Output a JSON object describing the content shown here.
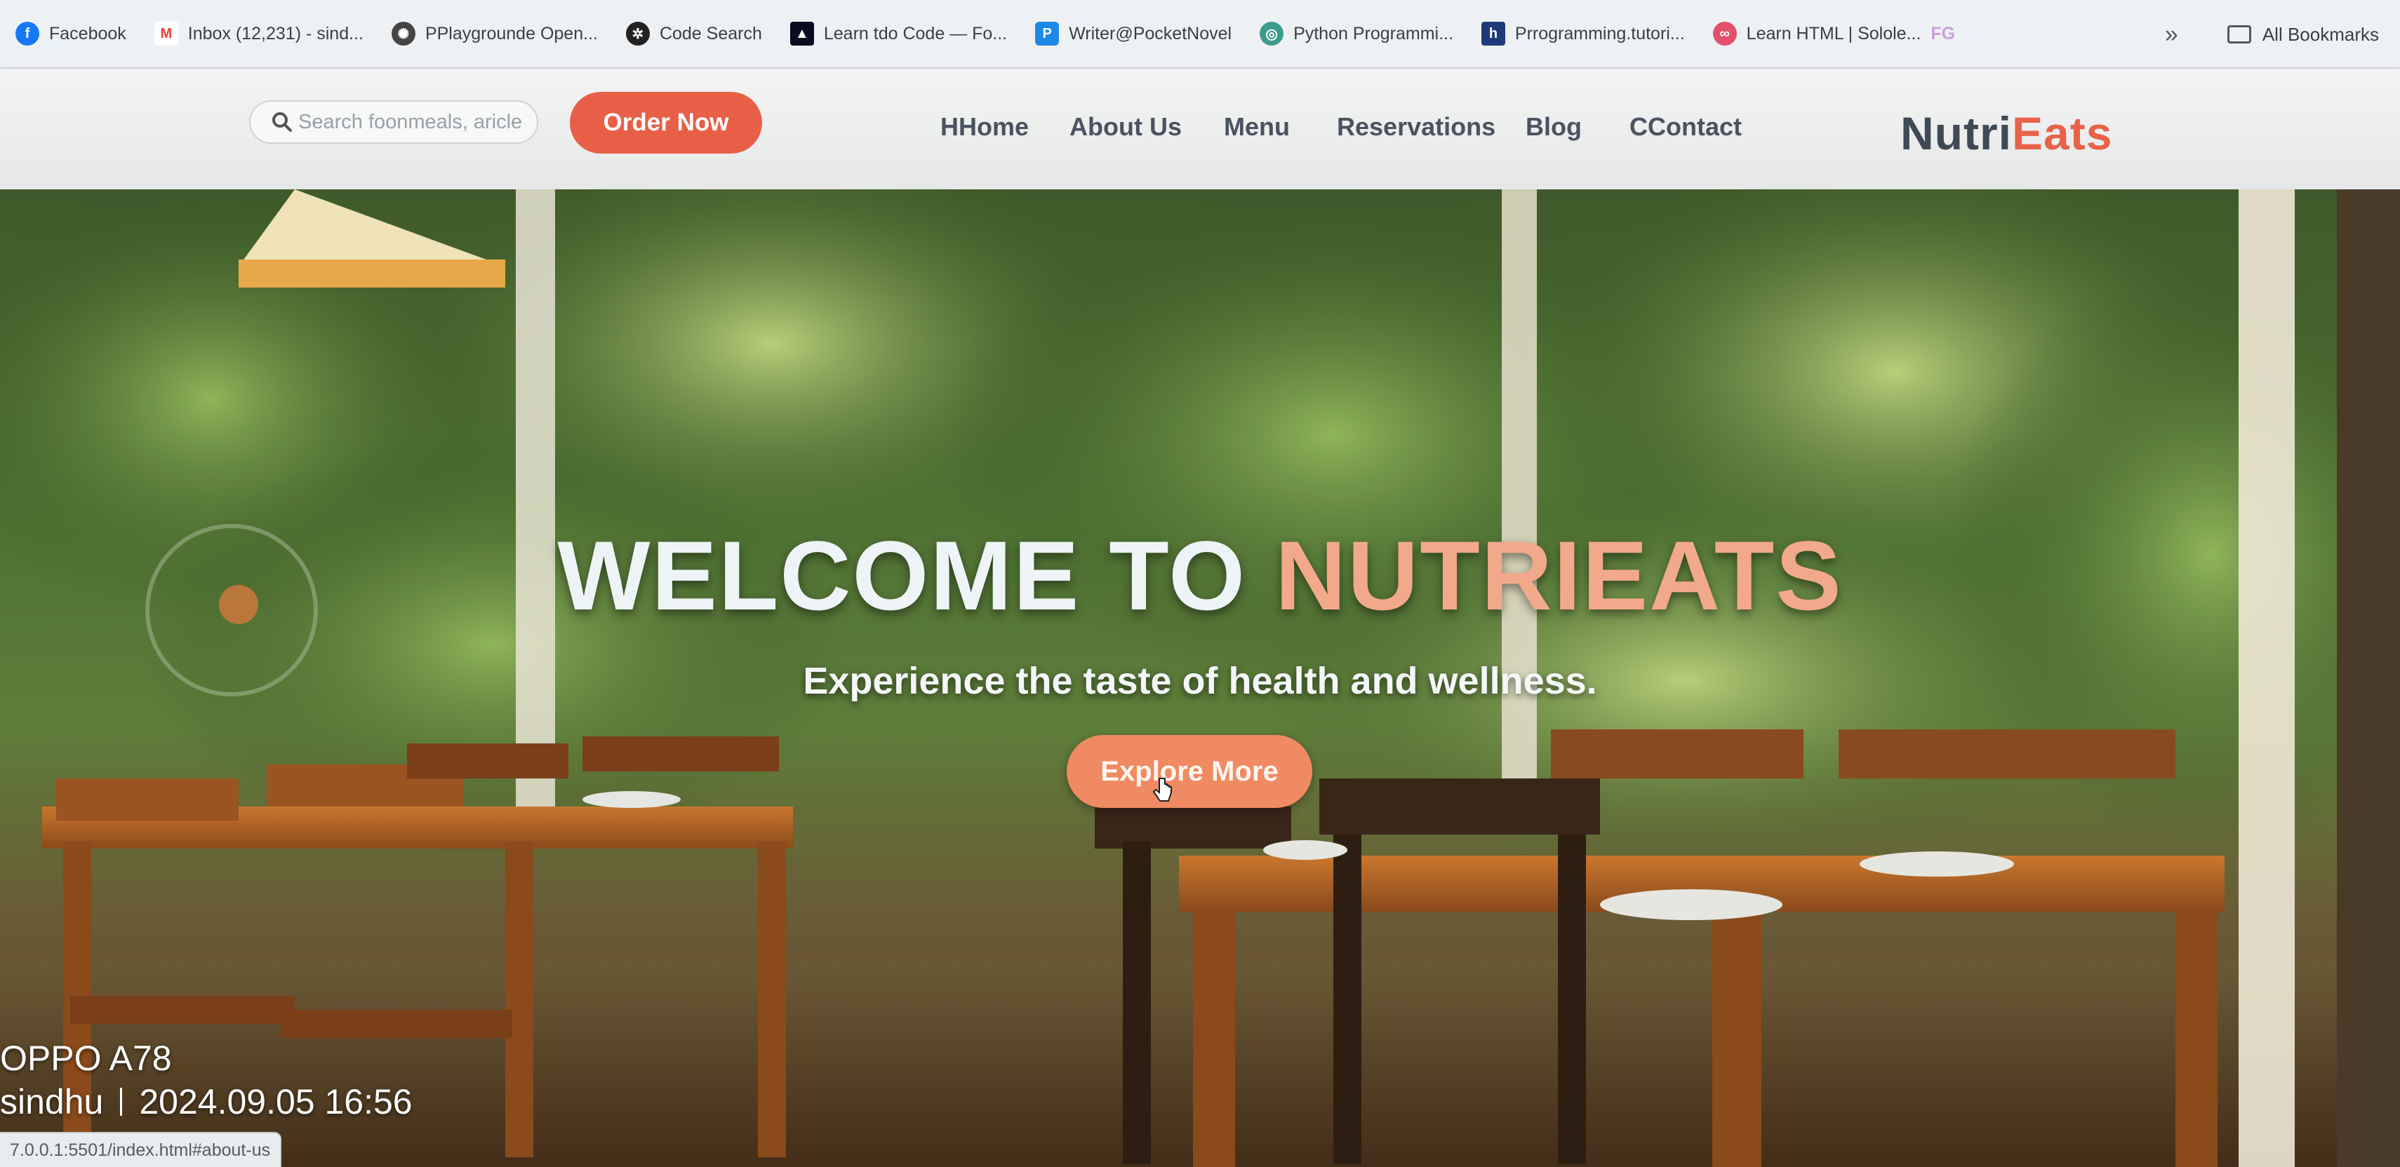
{
  "bookmarks": {
    "items": [
      {
        "label": "Facebook",
        "icon": "facebook-icon",
        "color": "#1877f2"
      },
      {
        "label": "Inbox (12,231) - sind...",
        "icon": "gmail-icon",
        "color": "#ea4335"
      },
      {
        "label": "PPlaygrounde Open...",
        "icon": "openai-icon",
        "color": "#444444"
      },
      {
        "label": "Code Search",
        "icon": "code-search-icon",
        "color": "#222222"
      },
      {
        "label": "Learn tdo Code — Fo...",
        "icon": "freecodecamp-icon",
        "color": "#0a0a23"
      },
      {
        "label": "Writer@PocketNovel",
        "icon": "pocketnovel-icon",
        "color": "#1e88e5"
      },
      {
        "label": "Python Programmi...",
        "icon": "python-site-icon",
        "color": "#3b9c8f"
      },
      {
        "label": "Prrogramming.tutori...",
        "icon": "h-site-icon",
        "color": "#1f3a7a"
      },
      {
        "label": "Learn HTML | Sololе...",
        "icon": "sololearn-icon",
        "color": "#e2506b"
      }
    ],
    "extra_badge": "FG",
    "overflow_icon": "chevron-double-right-icon",
    "all_bookmarks_label": "All Bookmarks"
  },
  "header": {
    "search_placeholder": "Search foonmeals, aricle",
    "order_button": "Order Now",
    "nav": [
      "HHome",
      "About Us",
      "Menu",
      "Reservations",
      "Blog",
      "CContact"
    ],
    "brand_part1": "Nutri",
    "brand_part2": "Eats"
  },
  "hero": {
    "title_part1": "WELCOME TO ",
    "title_part2": "NUTRIEATS",
    "subtitle": "Experience the taste of health and wellness.",
    "cta": "Explore More"
  },
  "overlay": {
    "camera_model": "OPPO A78",
    "camera_user": "sindhu",
    "camera_timestamp": "2024.09.05 16:56",
    "status_url": "7.0.0.1:5501/index.html#about-us"
  },
  "colors": {
    "accent": "#e85f47",
    "brand_dark": "#3f4a56",
    "title_highlight": "#f2a98b",
    "cta": "#f08a63"
  }
}
